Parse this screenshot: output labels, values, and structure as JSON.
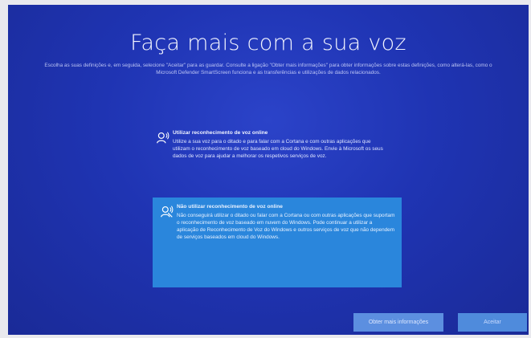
{
  "header": {
    "title": "Faça mais com a sua voz",
    "description": "Escolha as suas definições e, em seguida, selecione \"Aceitar\" para as guardar. Consulte a ligação \"Obter mais informações\" para obter informações sobre estas definições, como alterá-las, como o Microsoft Defender SmartScreen funciona e as transferências e utilizações de dados relacionados."
  },
  "options": [
    {
      "title": "Utilizar reconhecimento de voz online",
      "body": "Utilize a sua voz para o ditado e para falar com a Cortana e com outras aplicações que utilizam o reconhecimento de voz baseado em cloud do Windows. Envie à Microsoft os seus dados de voz para ajudar a melhorar os respetivos serviços de voz.",
      "icon": "speech-icon",
      "selected": false
    },
    {
      "title": "Não utilizar reconhecimento de voz online",
      "body": "Não conseguirá utilizar o ditado ou falar com a Cortana ou com outras aplicações que suportam o reconhecimento de voz baseado em nuvem do Windows. Pode continuar a utilizar a aplicação de Reconhecimento de Voz do Windows e outros serviços de voz que não dependem de serviços baseados em cloud do Windows.",
      "icon": "speech-off-icon",
      "selected": true
    }
  ],
  "buttons": {
    "more_info": "Obter mais informações",
    "accept": "Aceitar"
  },
  "colors": {
    "background": "#1f34b3",
    "selected_option": "#2a86dc",
    "button": "#5c8fe0"
  }
}
